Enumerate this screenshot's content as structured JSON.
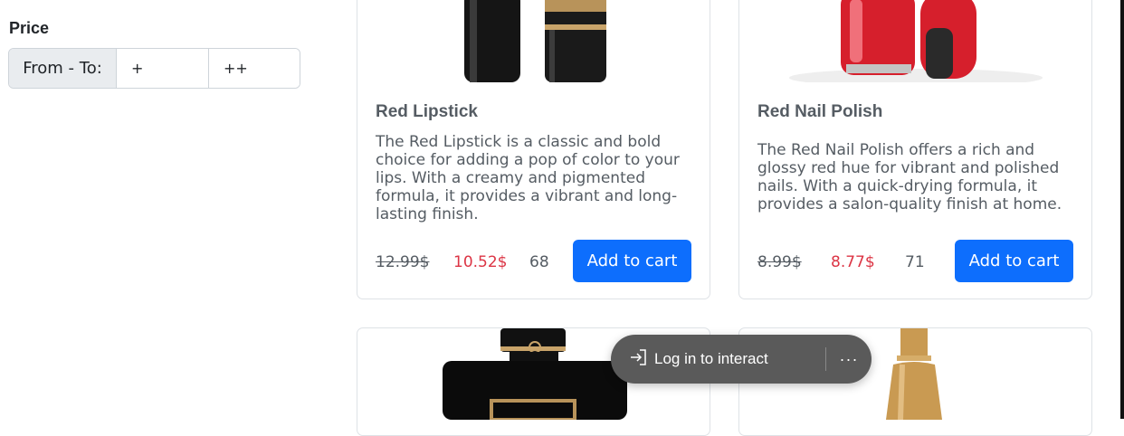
{
  "filter": {
    "title": "Price",
    "prefix": "From - To:",
    "from_placeholder": "+",
    "to_placeholder": "++"
  },
  "products": [
    {
      "title": "Red Lipstick",
      "description": "The Red Lipstick is a classic and bold choice for adding a pop of color to your lips. With a creamy and pigmented formula, it provides a vibrant and long-lasting finish.",
      "old_price": "12.99$",
      "new_price": "10.52$",
      "stock": "68",
      "button": "Add to cart"
    },
    {
      "title": "Red Nail Polish",
      "description": "The Red Nail Polish offers a rich and glossy red hue for vibrant and polished nails. With a quick-drying formula, it provides a salon-quality finish at home.",
      "old_price": "8.99$",
      "new_price": "8.77$",
      "stock": "71",
      "button": "Add to cart"
    }
  ],
  "overlay": {
    "login_label": "Log in to interact",
    "more_label": "···"
  },
  "colors": {
    "primary": "#0d6efd",
    "sale": "#dc3545",
    "overlay": "#5a5a5a"
  }
}
